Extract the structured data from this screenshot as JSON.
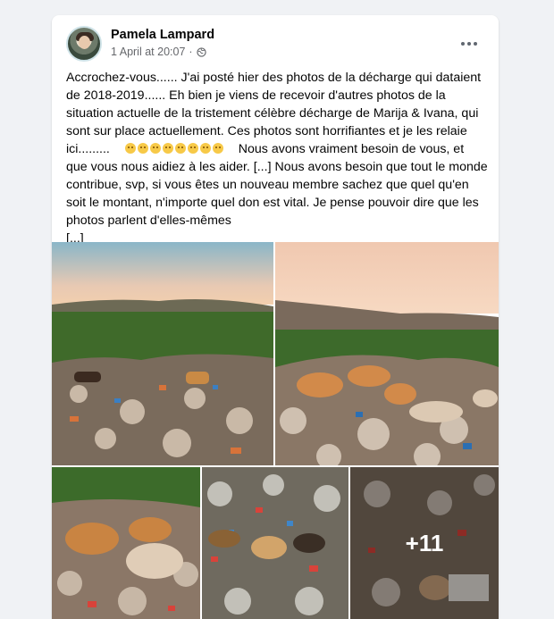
{
  "post": {
    "author": "Pamela Lampard",
    "timestamp": "1 April at 20:07",
    "separator": "·",
    "privacy_icon": "globe-icon",
    "options_icon": "more-options-icon",
    "body_part1": "Accrochez-vous...... J'ai posté hier des photos de la décharge qui dataient de 2018-2019...... Eh bien je viens de recevoir d'autres photos de la situation actuelle de la tristement célèbre décharge de Marija & Ivana, qui sont sur place actuellement. Ces photos sont horrifiantes et je les relaie ici.........",
    "body_part2": "Nous avons vraiment besoin de vous, et que vous nous aidiez à les aider. [...] Nous avons besoin que tout le monde contribue, svp, si vous êtes un nouveau membre sachez que quel qu'en soit le montant, n'importe quel don est vital. Je pense pouvoir dire que les photos parlent d'elles-mêmes",
    "see_more": "[...]",
    "emoji_count": 8,
    "emoji_name": "sad-face-emoji"
  },
  "photos": {
    "more_count": "+11"
  }
}
